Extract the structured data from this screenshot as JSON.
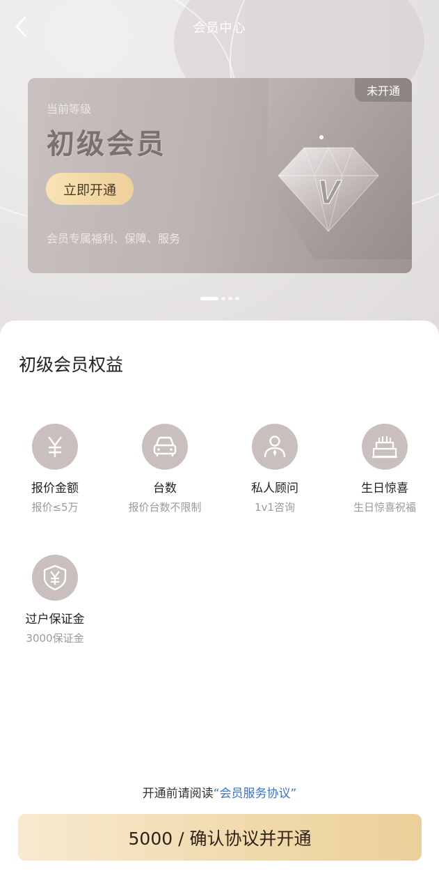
{
  "nav": {
    "title": "会员中心"
  },
  "card": {
    "badge": "未开通",
    "subtitle": "当前等级",
    "level": "初级会员",
    "open_button": "立即开通",
    "description": "会员专属福利、保障、服务"
  },
  "pager": {
    "count": 4,
    "active": 0
  },
  "benefits": {
    "title": "初级会员权益",
    "items": [
      {
        "name": "报价金额",
        "desc": "报价≤5万",
        "icon": "yuan-icon"
      },
      {
        "name": "台数",
        "desc": "报价台数不限制",
        "icon": "car-icon"
      },
      {
        "name": "私人顾问",
        "desc": "1v1咨询",
        "icon": "advisor-icon"
      },
      {
        "name": "生日惊喜",
        "desc": "生日惊喜祝福",
        "icon": "cake-icon"
      },
      {
        "name": "过户保证金",
        "desc": "3000保证金",
        "icon": "shield-yuan-icon"
      }
    ]
  },
  "agreement": {
    "prefix": "开通前请阅读",
    "link": "“会员服务协议”"
  },
  "confirm": {
    "label": "5000 / 确认协议并开通"
  },
  "colors": {
    "accent_gold": "#eed09a",
    "icon_bg": "#c9bfbd",
    "link_blue": "#3b6fd1"
  }
}
